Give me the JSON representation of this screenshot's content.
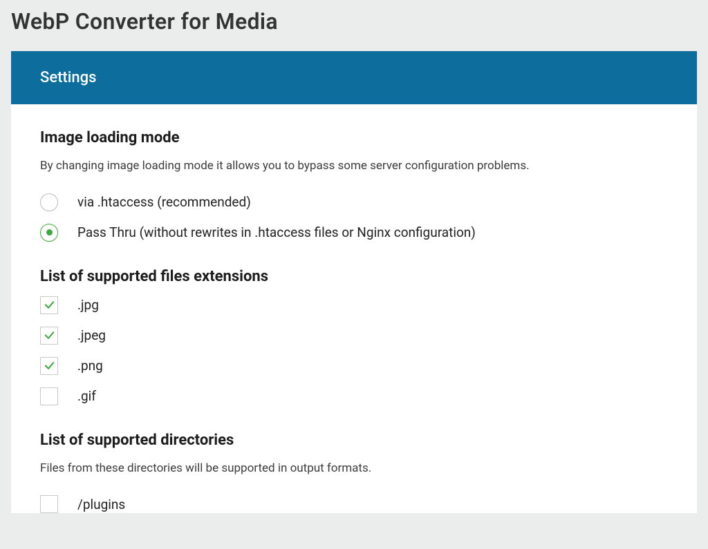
{
  "title": "WebP Converter for Media",
  "panel_header": "Settings",
  "sections": {
    "loading_mode": {
      "title": "Image loading mode",
      "description": "By changing image loading mode it allows you to bypass some server configuration problems.",
      "options": [
        {
          "label": "via .htaccess (recommended)",
          "selected": false
        },
        {
          "label": "Pass Thru (without rewrites in .htaccess files or Nginx configuration)",
          "selected": true
        }
      ]
    },
    "extensions": {
      "title": "List of supported files extensions",
      "items": [
        {
          "label": ".jpg",
          "checked": true
        },
        {
          "label": ".jpeg",
          "checked": true
        },
        {
          "label": ".png",
          "checked": true
        },
        {
          "label": ".gif",
          "checked": false
        }
      ]
    },
    "directories": {
      "title": "List of supported directories",
      "description": "Files from these directories will be supported in output formats.",
      "items": [
        {
          "label": "/plugins",
          "checked": false
        }
      ]
    }
  }
}
